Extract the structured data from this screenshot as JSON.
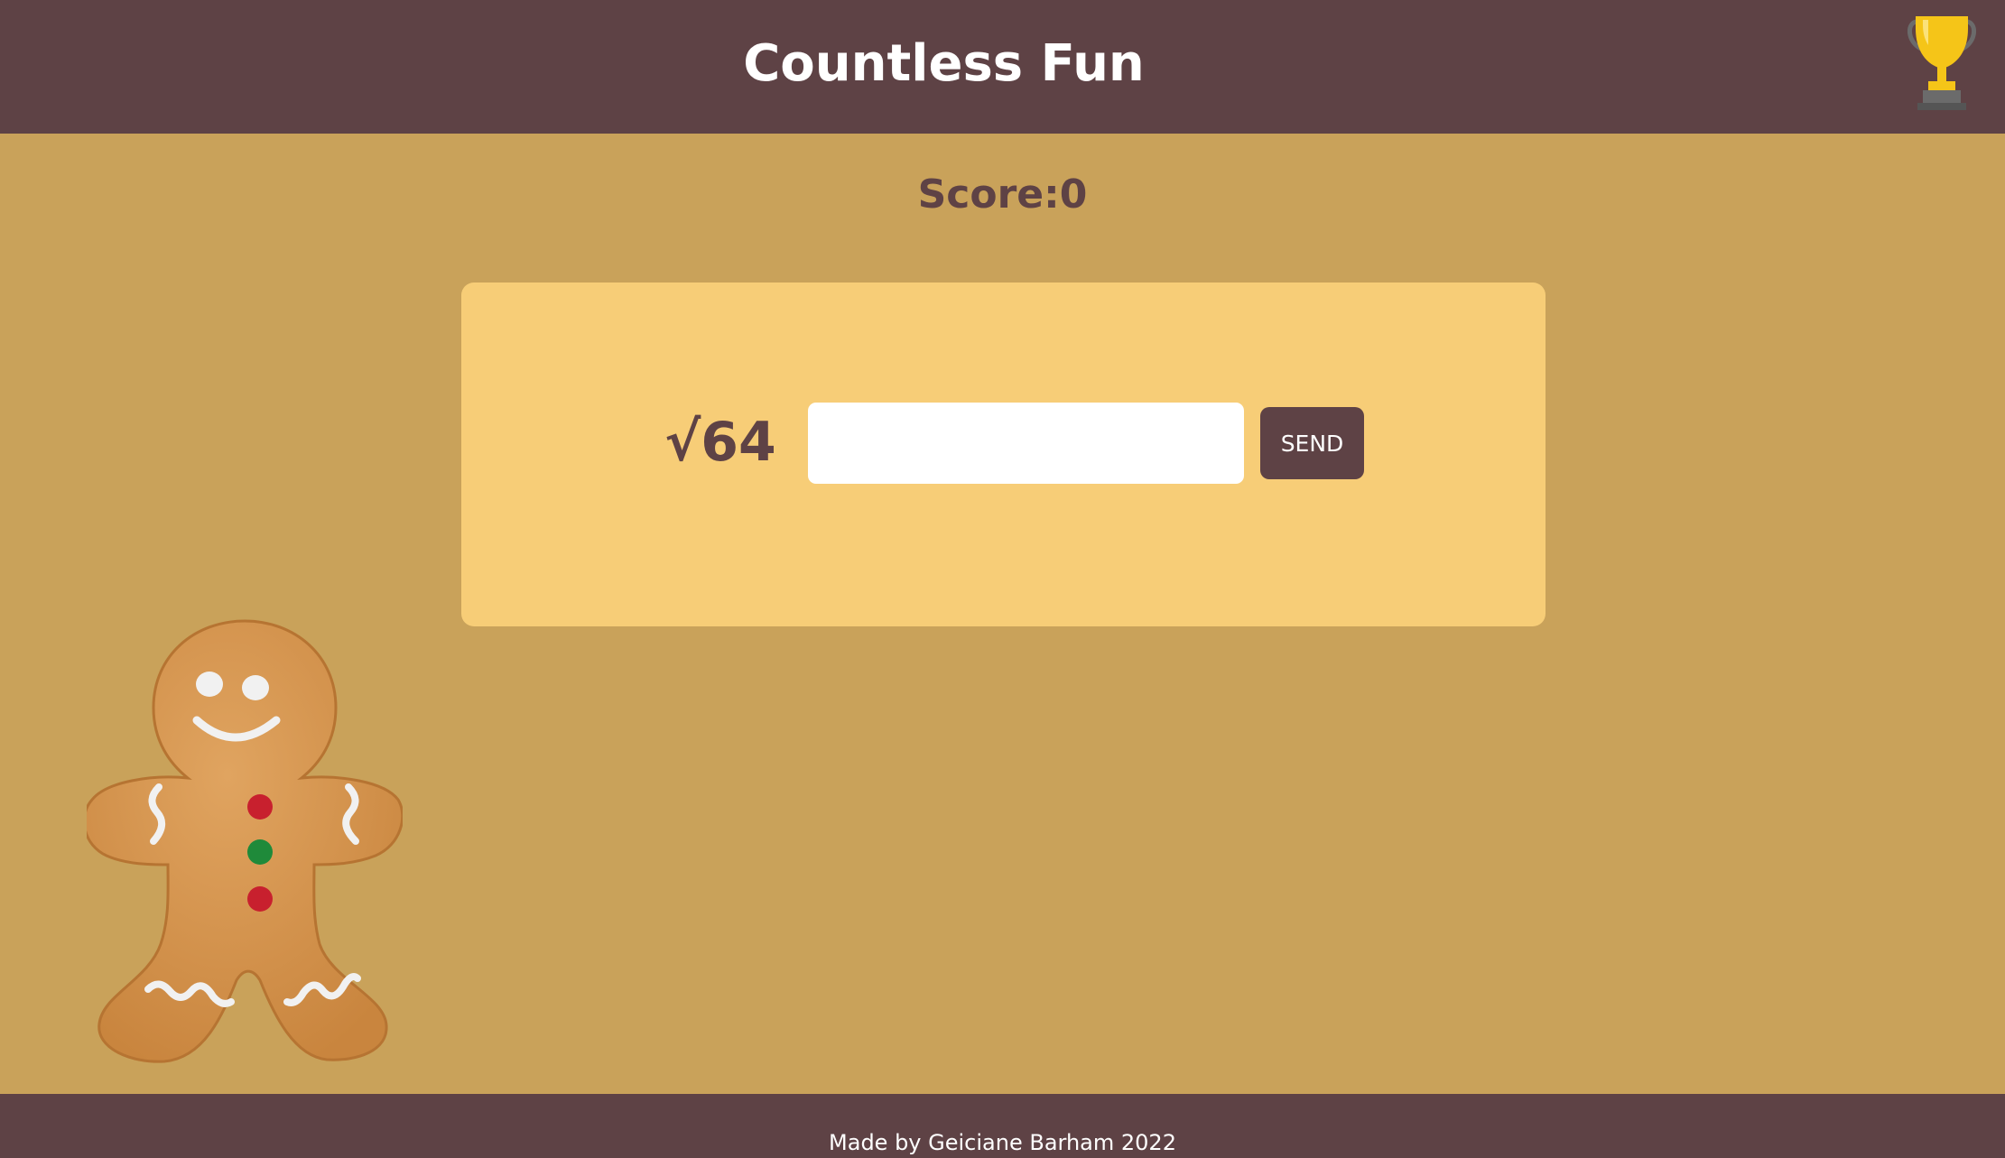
{
  "header": {
    "title": "Countless Fun",
    "trophy_icon": "trophy-icon"
  },
  "score": {
    "label": "Score:0"
  },
  "quiz": {
    "question": "√64",
    "answer_value": "",
    "send_label": "SEND"
  },
  "decoration": {
    "mascot_icon": "gingerbread-man-icon"
  },
  "footer": {
    "credit": "Made by Geiciane Barham 2022"
  },
  "colors": {
    "header_bg": "#5E4245",
    "page_bg": "#C9A25A",
    "card_bg": "#F7CD77",
    "accent": "#5E4245",
    "trophy_gold": "#F5C518"
  }
}
